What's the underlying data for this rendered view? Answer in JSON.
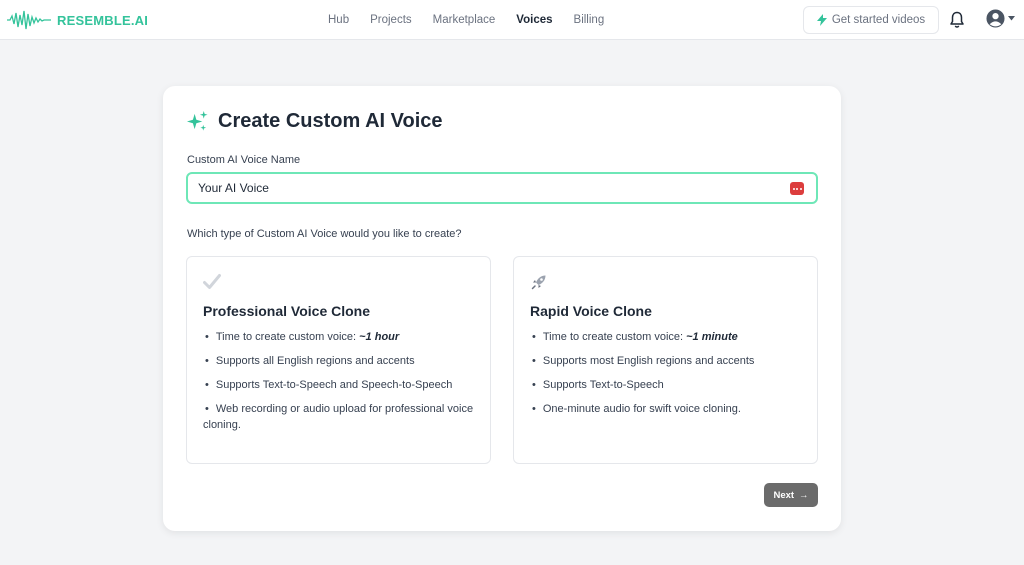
{
  "app": {
    "logo_text": "RESEMBLE.AI",
    "brand_color": "#34c39b"
  },
  "nav": {
    "items": [
      {
        "label": "Hub",
        "active": false
      },
      {
        "label": "Projects",
        "active": false
      },
      {
        "label": "Marketplace",
        "active": false
      },
      {
        "label": "Voices",
        "active": true
      },
      {
        "label": "Billing",
        "active": false
      }
    ],
    "get_started_label": "Get started videos"
  },
  "card": {
    "title": "Create Custom AI Voice",
    "name_label": "Custom AI Voice Name",
    "name_value": "Your AI Voice",
    "question": "Which type of Custom AI Voice would you like to create?",
    "options": [
      {
        "title": "Professional Voice Clone",
        "icon": "checkmark-icon",
        "bullets": [
          {
            "text": "Time to create custom voice: ",
            "emphasis": "~1 hour"
          },
          {
            "text": "Supports all English regions and accents",
            "emphasis": ""
          },
          {
            "text": "Supports Text-to-Speech and Speech-to-Speech",
            "emphasis": ""
          },
          {
            "text": "Web recording or audio upload for professional voice cloning.",
            "emphasis": ""
          }
        ]
      },
      {
        "title": "Rapid Voice Clone",
        "icon": "rocket-icon",
        "bullets": [
          {
            "text": "Time to create custom voice: ",
            "emphasis": "~1 minute"
          },
          {
            "text": "Supports most English regions and accents",
            "emphasis": ""
          },
          {
            "text": "Supports Text-to-Speech",
            "emphasis": ""
          },
          {
            "text": "One-minute audio for swift voice cloning.",
            "emphasis": ""
          }
        ]
      }
    ],
    "next_label": "Next",
    "next_arrow": "→"
  }
}
